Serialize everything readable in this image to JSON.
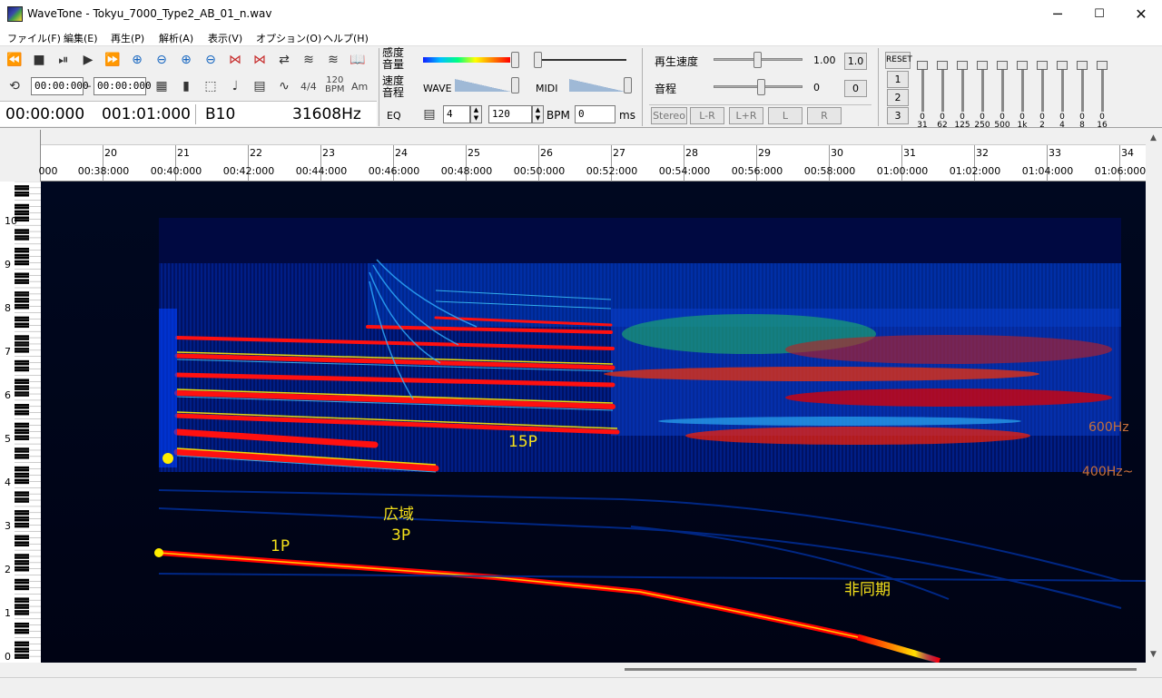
{
  "window": {
    "title": "WaveTone - Tokyu_7000_Type2_AB_01_n.wav",
    "minimize": "─",
    "maximize": "☐",
    "close": "✕"
  },
  "menu": [
    "ファイル(F)",
    "編集(E)",
    "再生(P)",
    "解析(A)",
    "表示(V)",
    "オプション(O)",
    "ヘルプ(H)"
  ],
  "toolbar": {
    "loop_start": "00:00:000",
    "loop_dash": "–",
    "loop_end": "00:00:000",
    "time_sig": "4/4",
    "bpm_icon_top": "120",
    "bpm_icon_bottom": "BPM",
    "key_icon": "Am",
    "position_time": "00:00:000",
    "position_bar": "001:01:000",
    "note": "B10",
    "frequency": "31608Hz",
    "label_sensitivity_1": "感度",
    "label_sensitivity_2": "音量",
    "label_speed_1": "速度",
    "label_speed_2": "音程",
    "eq_label": "EQ",
    "wave_label": "WAVE",
    "midi_label": "MIDI",
    "beats_value": "4",
    "bpm_value": "120",
    "bpm_label": "BPM",
    "ms_value": "0",
    "ms_label": "ms",
    "playback_speed_label": "再生速度",
    "playback_speed_value": "1.00",
    "playback_speed_reset": "1.0",
    "pitch_label": "音程",
    "pitch_value": "0",
    "pitch_reset": "0",
    "stereo_label": "Stereo",
    "mode_lr_minus": "L-R",
    "mode_lr_plus": "L+R",
    "mode_l": "L",
    "mode_r": "R",
    "reset": "RESET",
    "preset_1": "1",
    "preset_2": "2",
    "preset_3": "3",
    "eq_bands": [
      "31",
      "62",
      "125",
      "250",
      "500",
      "1k",
      "2",
      "4",
      "8",
      "16"
    ],
    "eq_values": [
      "0",
      "0",
      "0",
      "0",
      "0",
      "0",
      "0",
      "0",
      "0",
      "0"
    ]
  },
  "ruler": {
    "bars": [
      "20",
      "21",
      "22",
      "23",
      "24",
      "25",
      "26",
      "27",
      "28",
      "29",
      "30",
      "31",
      "32",
      "33",
      "34"
    ],
    "times": [
      "000",
      "00:38:000",
      "00:40:000",
      "00:42:000",
      "00:44:000",
      "00:46:000",
      "00:48:000",
      "00:50:000",
      "00:52:000",
      "00:54:000",
      "00:56:000",
      "00:58:000",
      "01:00:000",
      "01:02:000",
      "01:04:000",
      "01:06:000"
    ]
  },
  "piano": {
    "octaves": [
      "10",
      "9",
      "8",
      "7",
      "6",
      "5",
      "4",
      "3",
      "2",
      "1",
      "0"
    ]
  },
  "annotations": {
    "label_1p": "1P",
    "label_kouiki": "広域",
    "label_3p": "3P",
    "label_15p": "15P",
    "label_hidouki": "非同期",
    "label_600hz": "600Hz",
    "label_400hz": "400Hz~"
  }
}
